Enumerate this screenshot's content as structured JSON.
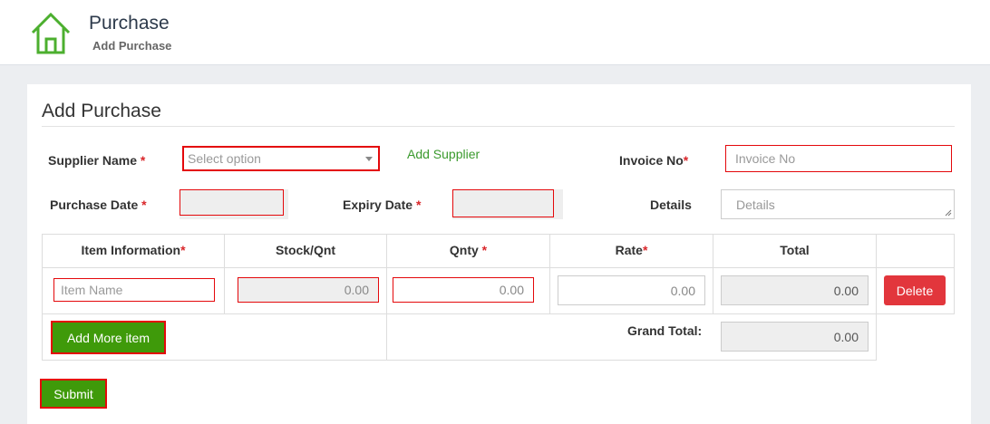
{
  "header": {
    "title": "Purchase",
    "subtitle": "Add Purchase",
    "icon": "home-icon"
  },
  "form": {
    "title": "Add Purchase",
    "supplier_label": "Supplier Name",
    "supplier_placeholder": "Select option",
    "add_supplier_link": "Add Supplier",
    "invoice_label": "Invoice No",
    "invoice_placeholder": "Invoice No",
    "purchase_date_label": "Purchase Date",
    "expiry_date_label": "Expiry Date",
    "details_label": "Details",
    "details_placeholder": "Details",
    "required_mark": "*"
  },
  "table": {
    "headers": {
      "item": "Item Information",
      "stock": "Stock/Qnt",
      "qnty": "Qnty",
      "rate": "Rate",
      "total": "Total"
    },
    "row": {
      "item_placeholder": "Item Name",
      "stock": "0.00",
      "qnty": "0.00",
      "rate": "0.00",
      "total": "0.00",
      "delete_label": "Delete"
    },
    "add_more_label": "Add More item",
    "grand_total_label": "Grand Total:",
    "grand_total_value": "0.00"
  },
  "submit_label": "Submit",
  "colors": {
    "accent": "#3f9a0a",
    "danger": "#e2363c",
    "highlight": "#e4080b"
  }
}
